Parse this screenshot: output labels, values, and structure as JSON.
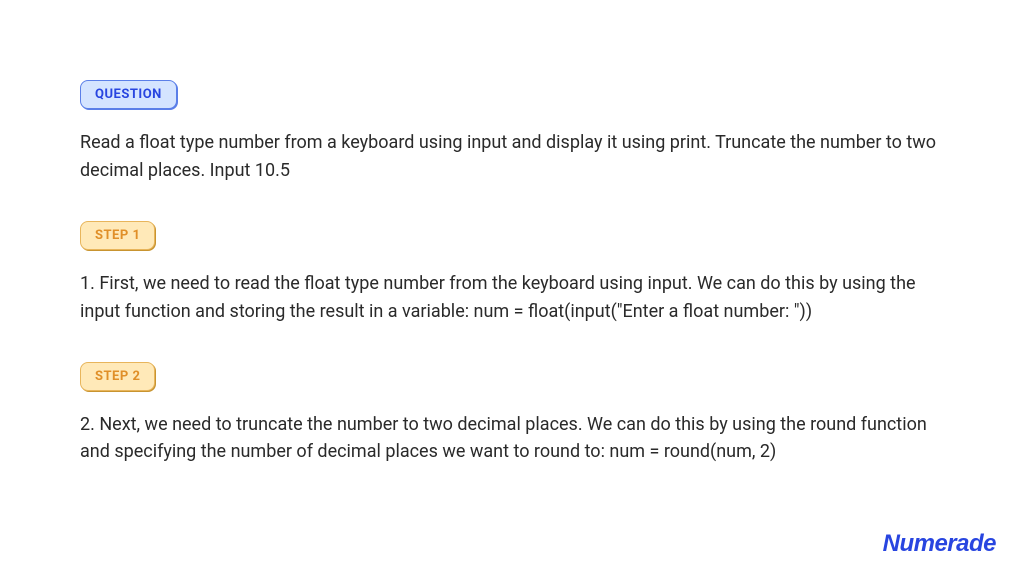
{
  "question": {
    "badge": "QUESTION",
    "text": "Read a float type number from a keyboard using input and display it using print. Truncate the number to two decimal places. Input 10.5"
  },
  "steps": [
    {
      "badge": "STEP 1",
      "text": "1. First, we need to read the float type number from the keyboard using input. We can do this by using the input function and storing the result in a variable: num = float(input(\"Enter a float number: \"))"
    },
    {
      "badge": "STEP 2",
      "text": "2. Next, we need to truncate the number to two decimal places. We can do this by using the round function and specifying the number of decimal places we want to round to: num = round(num, 2)"
    }
  ],
  "brand": "Numerade"
}
